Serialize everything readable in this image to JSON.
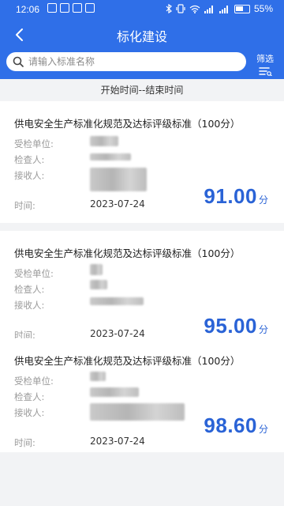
{
  "status_bar": {
    "time": "12:06",
    "battery": "55%"
  },
  "header": {
    "title": "标化建设",
    "back_icon": "chevron-left-icon"
  },
  "search": {
    "placeholder": "请输入标准名称",
    "value": ""
  },
  "filter": {
    "label": "筛选",
    "icon": "filter-icon"
  },
  "time_range": "开始时间--结束时间",
  "labels": {
    "inspected_unit": "受检单位:",
    "inspector": "检查人:",
    "receiver": "接收人:",
    "time": "时间:"
  },
  "records": [
    {
      "title": "供电安全生产标准化规范及达标评级标准（100分）",
      "date": "2023-07-24",
      "score": "91.00",
      "unit": "分"
    },
    {
      "title": "供电安全生产标准化规范及达标评级标准（100分）",
      "date": "2023-07-24",
      "score": "95.00",
      "unit": "分"
    },
    {
      "title": "供电安全生产标准化规范及达标评级标准（100分）",
      "date": "2023-07-24",
      "score": "98.60",
      "unit": "分"
    }
  ],
  "colors": {
    "header": "#2f6fe8",
    "score": "#2a63d6",
    "background": "#f2f3f5"
  }
}
